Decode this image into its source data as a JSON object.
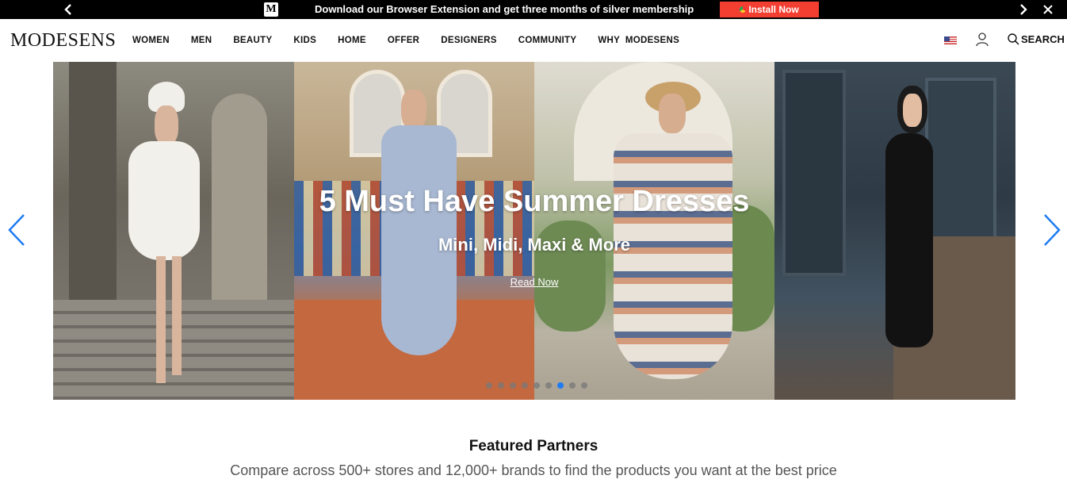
{
  "promo": {
    "logo_letter": "M",
    "message": "Download our Browser Extension and get three months of silver membership",
    "install_label": "Install Now",
    "install_color": "#f23f31"
  },
  "header": {
    "brand": "MODESENS",
    "nav": [
      "WOMEN",
      "MEN",
      "BEAUTY",
      "KIDS",
      "HOME",
      "OFFER",
      "DESIGNERS",
      "COMMUNITY",
      "WHY  MODESENS"
    ],
    "search_label": "SEARCH",
    "icons": [
      "us-flag-icon",
      "user-icon",
      "search-icon"
    ]
  },
  "hero": {
    "title": "5 Must Have Summer Dresses",
    "subtitle": "Mini, Midi, Maxi & More",
    "link": "Read Now",
    "slides_total": 9,
    "active_slide": 7,
    "accent_color": "#1e7cf2"
  },
  "featured": {
    "title": "Featured Partners",
    "subtitle": "Compare across 500+ stores and 12,000+ brands to find the products you want at the best price"
  }
}
